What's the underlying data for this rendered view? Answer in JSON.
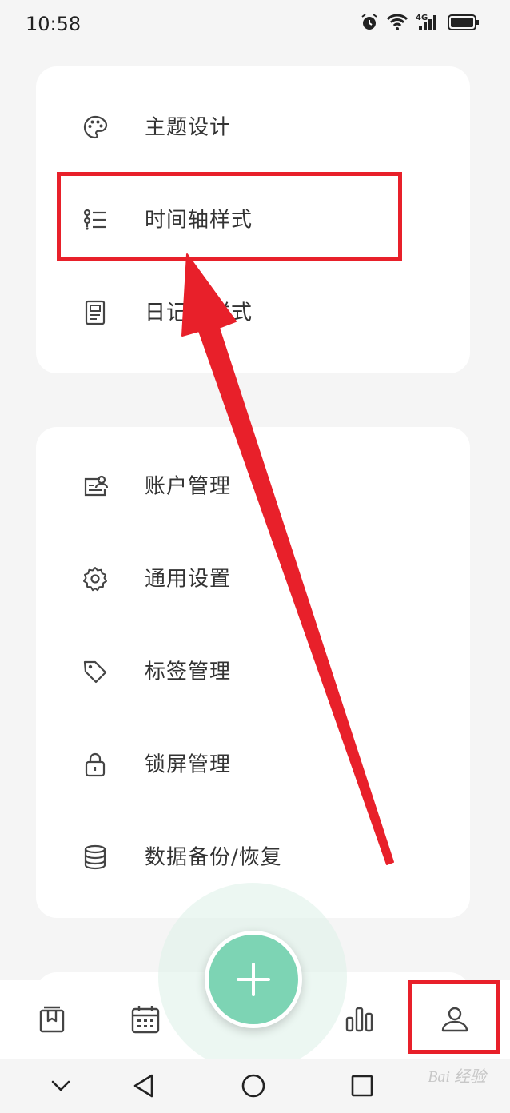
{
  "status": {
    "time": "10:58"
  },
  "menu_group_1": [
    {
      "label": "主题设计",
      "icon": "palette-icon"
    },
    {
      "label": "时间轴样式",
      "icon": "timeline-list-icon"
    },
    {
      "label": "日记页样式",
      "icon": "document-page-icon"
    }
  ],
  "menu_group_2": [
    {
      "label": "账户管理",
      "icon": "account-card-icon"
    },
    {
      "label": "通用设置",
      "icon": "gear-icon"
    },
    {
      "label": "标签管理",
      "icon": "tag-icon"
    },
    {
      "label": "锁屏管理",
      "icon": "lock-icon"
    },
    {
      "label": "数据备份/恢复",
      "icon": "database-icon"
    }
  ],
  "bottom_nav": [
    "diary-book-icon",
    "calendar-icon",
    "stats-bar-icon",
    "profile-icon"
  ],
  "watermark": "Bai 经验",
  "colors": {
    "accent": "#7dd4b4",
    "annotation": "#e8202a"
  }
}
